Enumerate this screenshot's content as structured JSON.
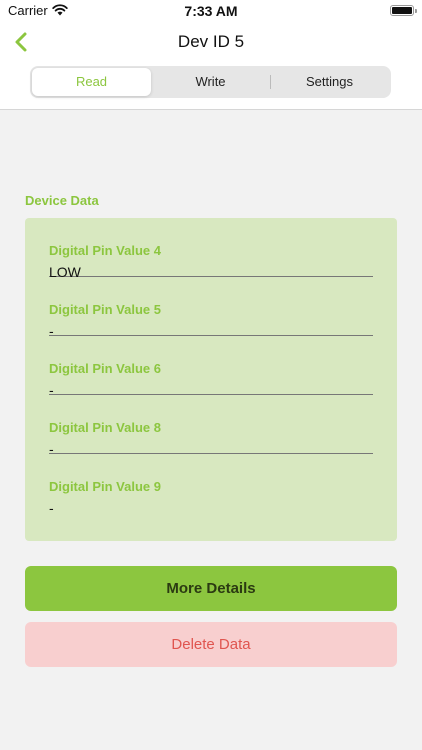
{
  "status_bar": {
    "carrier": "Carrier",
    "time": "7:33 AM"
  },
  "nav": {
    "title": "Dev ID 5",
    "back_icon": "chevron-left-icon"
  },
  "tabs": [
    {
      "label": "Read",
      "active": true
    },
    {
      "label": "Write",
      "active": false
    },
    {
      "label": "Settings",
      "active": false
    }
  ],
  "section": {
    "label": "Device Data"
  },
  "fields": [
    {
      "label": "Digital Pin Value 4",
      "value": "LOW"
    },
    {
      "label": "Digital Pin Value 5",
      "value": "-"
    },
    {
      "label": "Digital Pin Value 6",
      "value": "-"
    },
    {
      "label": "Digital Pin Value 8",
      "value": "-"
    },
    {
      "label": "Digital Pin Value 9",
      "value": "-"
    }
  ],
  "buttons": {
    "more_details": "More Details",
    "delete_data": "Delete Data"
  },
  "colors": {
    "accent": "#8cc63f",
    "card_bg": "#d8e8c0",
    "delete_bg": "#f8cfcf",
    "delete_text": "#e0554f"
  }
}
